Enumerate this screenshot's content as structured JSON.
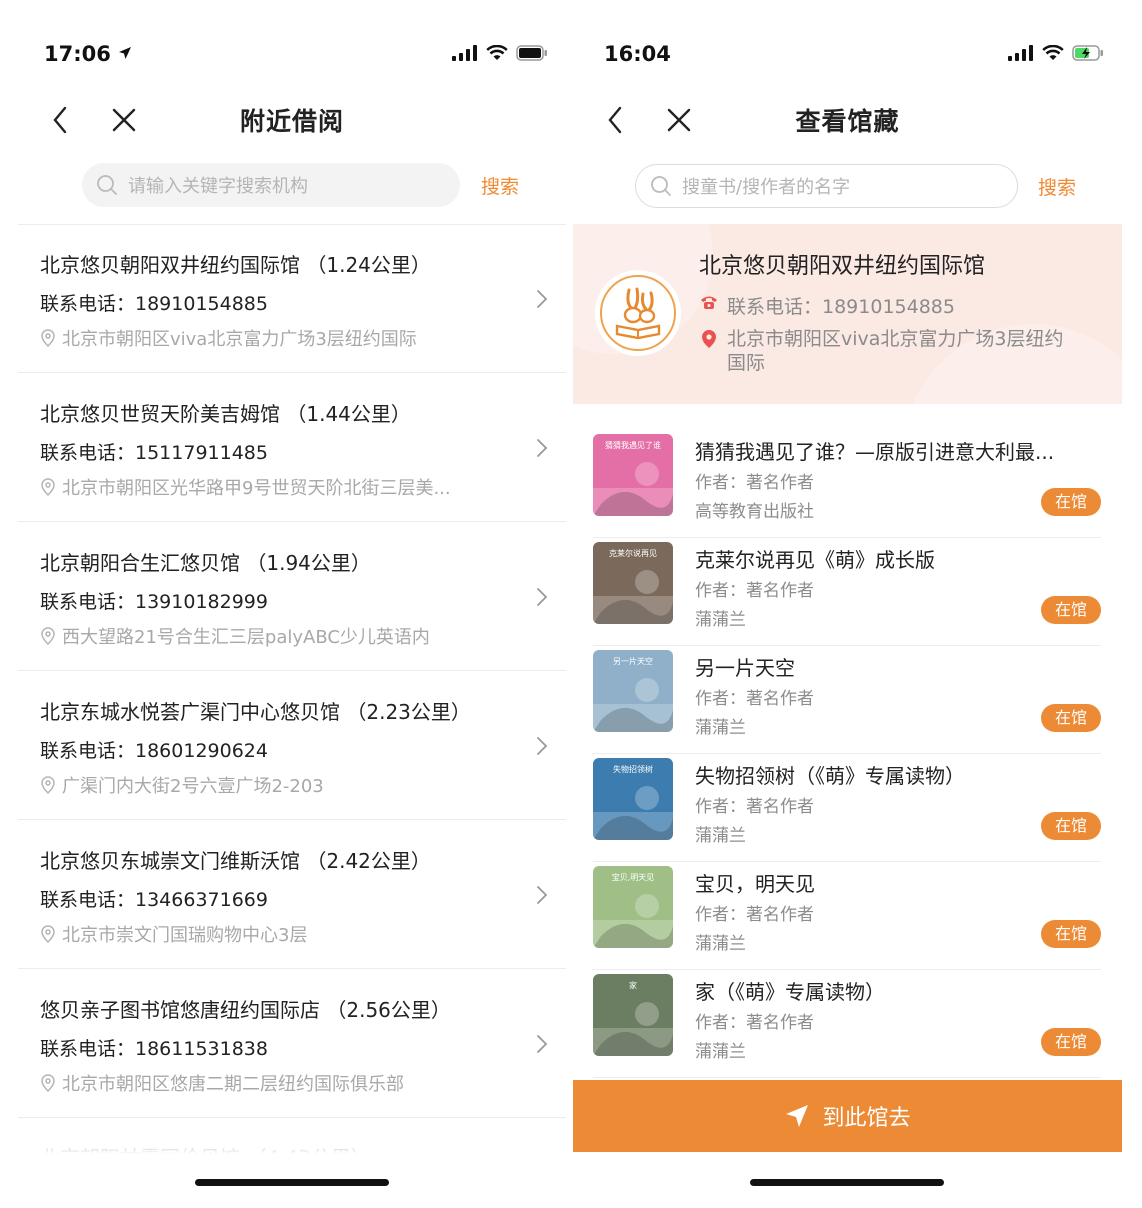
{
  "left": {
    "status": {
      "time": "17:06"
    },
    "title": "附近借阅",
    "search": {
      "placeholder": "请输入关键字搜索机构",
      "button": "搜索"
    },
    "libraries": [
      {
        "name": "北京悠贝朝阳双井纽约国际馆 （1.24公里）",
        "phone": "联系电话：18910154885",
        "address": "北京市朝阳区viva北京富力广场3层纽约国际"
      },
      {
        "name": "北京悠贝世贸天阶美吉姆馆 （1.44公里）",
        "phone": "联系电话：15117911485",
        "address": "北京市朝阳区光华路甲9号世贸天阶北街三层美..."
      },
      {
        "name": "北京朝阳合生汇悠贝馆 （1.94公里）",
        "phone": "联系电话：13910182999",
        "address": "西大望路21号合生汇三层palyABC少儿英语内"
      },
      {
        "name": "北京东城水悦荟广渠门中心悠贝馆 （2.23公里）",
        "phone": "联系电话：18601290624",
        "address": "广渠门内大街2号六壹广场2-203"
      },
      {
        "name": "北京悠贝东城崇文门维斯沃馆 （2.42公里）",
        "phone": "联系电话：13466371669",
        "address": "北京市崇文门国瑞购物中心3层"
      },
      {
        "name": "悠贝亲子图书馆悠唐纽约国际店 （2.56公里）",
        "phone": "联系电话：18611531838",
        "address": "北京市朝阳区悠唐二期二层纽约国际俱乐部"
      }
    ]
  },
  "right": {
    "status": {
      "time": "16:04"
    },
    "title": "查看馆藏",
    "search": {
      "placeholder": "搜童书/搜作者的名字",
      "button": "搜索"
    },
    "library": {
      "name": "北京悠贝朝阳双井纽约国际馆",
      "phone": "联系电话：18910154885",
      "address": "北京市朝阳区viva北京富力广场3层纽约国际"
    },
    "books": [
      {
        "title": "猜猜我遇见了谁？—原版引进意大利最...",
        "author": "作者：著名作者",
        "publisher": "高等教育出版社",
        "status": "在馆",
        "cover_color": "#e46fa6",
        "cover_text": "猜猜我遇见了谁"
      },
      {
        "title": "克莱尔说再见《萌》成长版",
        "author": "作者：著名作者",
        "publisher": "蒲蒲兰",
        "status": "在馆",
        "cover_color": "#7b6a5b",
        "cover_text": "克莱尔说再见"
      },
      {
        "title": "另一片天空",
        "author": "作者：著名作者",
        "publisher": "蒲蒲兰",
        "status": "在馆",
        "cover_color": "#8fb0c8",
        "cover_text": "另一片天空"
      },
      {
        "title": "失物招领树（《萌》专属读物）",
        "author": "作者：著名作者",
        "publisher": "蒲蒲兰",
        "status": "在馆",
        "cover_color": "#3d7cae",
        "cover_text": "失物招领树"
      },
      {
        "title": "宝贝，明天见",
        "author": "作者：著名作者",
        "publisher": "蒲蒲兰",
        "status": "在馆",
        "cover_color": "#9fbf86",
        "cover_text": "宝贝,明天见"
      },
      {
        "title": "家（《萌》专属读物）",
        "author": "作者：著名作者",
        "publisher": "蒲蒲兰",
        "status": "在馆",
        "cover_color": "#6c7e62",
        "cover_text": "家"
      }
    ],
    "go_button": "到此馆去"
  },
  "colors": {
    "accent": "#ec8a35",
    "header_bg": "#fbe9e4"
  }
}
